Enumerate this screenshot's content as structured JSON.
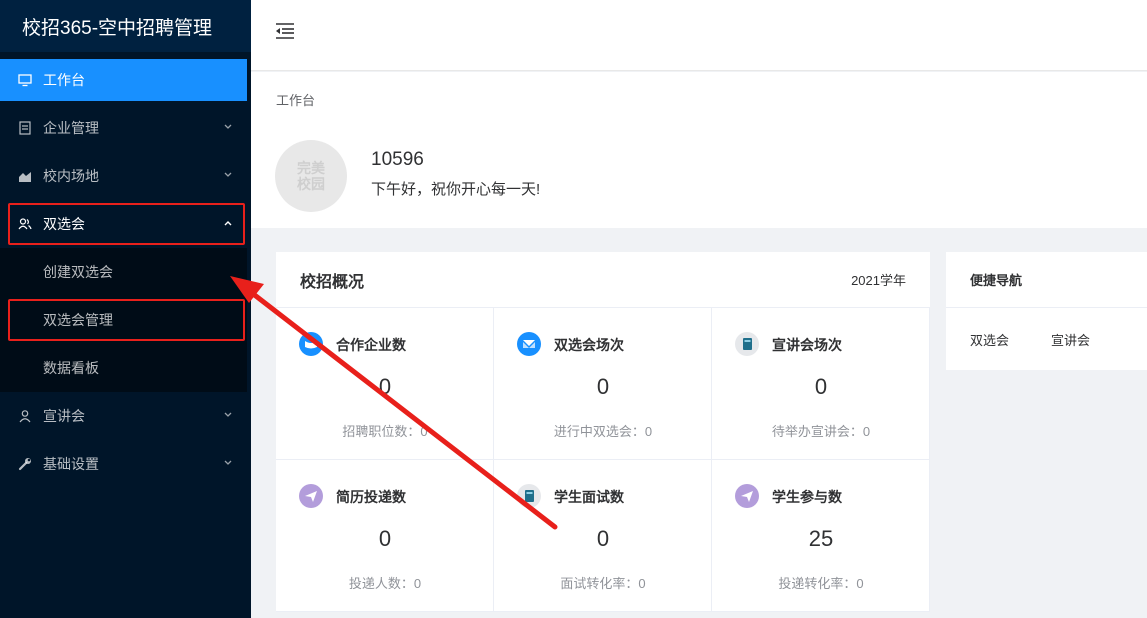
{
  "app": {
    "title": "校招365-空中招聘管理"
  },
  "sidebar": {
    "items": [
      {
        "label": "工作台",
        "icon": "monitor-icon"
      },
      {
        "label": "企业管理",
        "icon": "document-icon"
      },
      {
        "label": "校内场地",
        "icon": "area-chart-icon"
      },
      {
        "label": "双选会",
        "icon": "users-icon"
      },
      {
        "label": "宣讲会",
        "icon": "user-icon"
      },
      {
        "label": "基础设置",
        "icon": "wrench-icon"
      }
    ],
    "submenu": [
      {
        "label": "创建双选会"
      },
      {
        "label": "双选会管理"
      },
      {
        "label": "数据看板"
      }
    ]
  },
  "breadcrumb": "工作台",
  "profile": {
    "avatar_text": "完美校园",
    "name": "10596",
    "greeting": "下午好，祝你开心每一天!"
  },
  "stats": {
    "title": "校招概况",
    "year": "2021学年",
    "cells": [
      {
        "title": "合作企业数",
        "value": "0",
        "sub": "招聘职位数：0",
        "icon": "chat-icon",
        "icon_color": "#1890ff"
      },
      {
        "title": "双选会场次",
        "value": "0",
        "sub": "进行中双选会：0",
        "icon": "mail-icon",
        "icon_color": "#1890ff"
      },
      {
        "title": "宣讲会场次",
        "value": "0",
        "sub": "待举办宣讲会：0",
        "icon": "book-icon",
        "icon_color": "#e6e8eb"
      },
      {
        "title": "简历投递数",
        "value": "0",
        "sub": "投递人数：0",
        "icon": "send-icon",
        "icon_color": "#b39ddb"
      },
      {
        "title": "学生面试数",
        "value": "0",
        "sub": "面试转化率：0",
        "icon": "book-icon",
        "icon_color": "#e6e8eb"
      },
      {
        "title": "学生参与数",
        "value": "25",
        "sub": "投递转化率：0",
        "icon": "send-icon",
        "icon_color": "#b39ddb"
      }
    ]
  },
  "quicknav": {
    "title": "便捷导航",
    "links": [
      {
        "label": "双选会"
      },
      {
        "label": "宣讲会"
      }
    ]
  },
  "colors": {
    "sidebar": "#001529",
    "accent": "#1890ff",
    "highlight": "#e8201b"
  }
}
